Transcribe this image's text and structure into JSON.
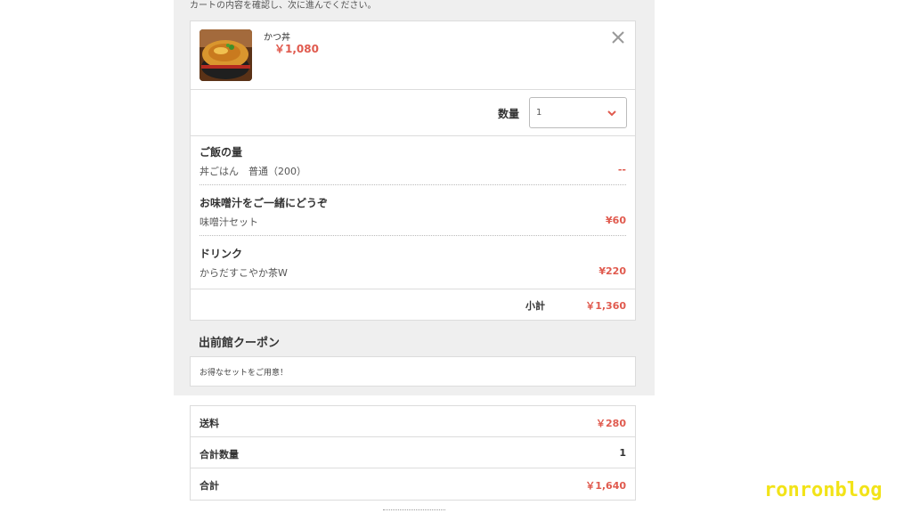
{
  "header": {
    "note": "カートの内容を確認し、次に進んでください。"
  },
  "item": {
    "name": "かつ丼",
    "price": "￥1,080",
    "image_icon": "katsudon-photo",
    "close_icon": "close-icon"
  },
  "quantity": {
    "label": "数量",
    "value": "1",
    "chevron_icon": "chevron-down-icon"
  },
  "options": [
    {
      "title": "ご飯の量",
      "value": "丼ごはん　普通（200）",
      "price": "--"
    },
    {
      "title": "お味噌汁をご一緒にどうぞ",
      "value": "味噌汁セット",
      "price": "¥60"
    },
    {
      "title": "ドリンク",
      "value": "からだすこやか茶W",
      "price": "¥220"
    }
  ],
  "subtotal": {
    "label": "小計",
    "value": "￥1,360"
  },
  "coupon": {
    "heading": "出前館クーポン",
    "text": "お得なセットをご用意！"
  },
  "summary": [
    {
      "label": "送料",
      "value": "￥280",
      "accent": true
    },
    {
      "label": "合計数量",
      "value": "1",
      "accent": false
    },
    {
      "label": "合計",
      "value": "￥1,640",
      "accent": true
    }
  ],
  "watermark": "ronronblog",
  "colors": {
    "accent": "#e05a4e",
    "panel": "#efefef",
    "border": "#dcdcdc",
    "watermark": "#f2e318"
  }
}
